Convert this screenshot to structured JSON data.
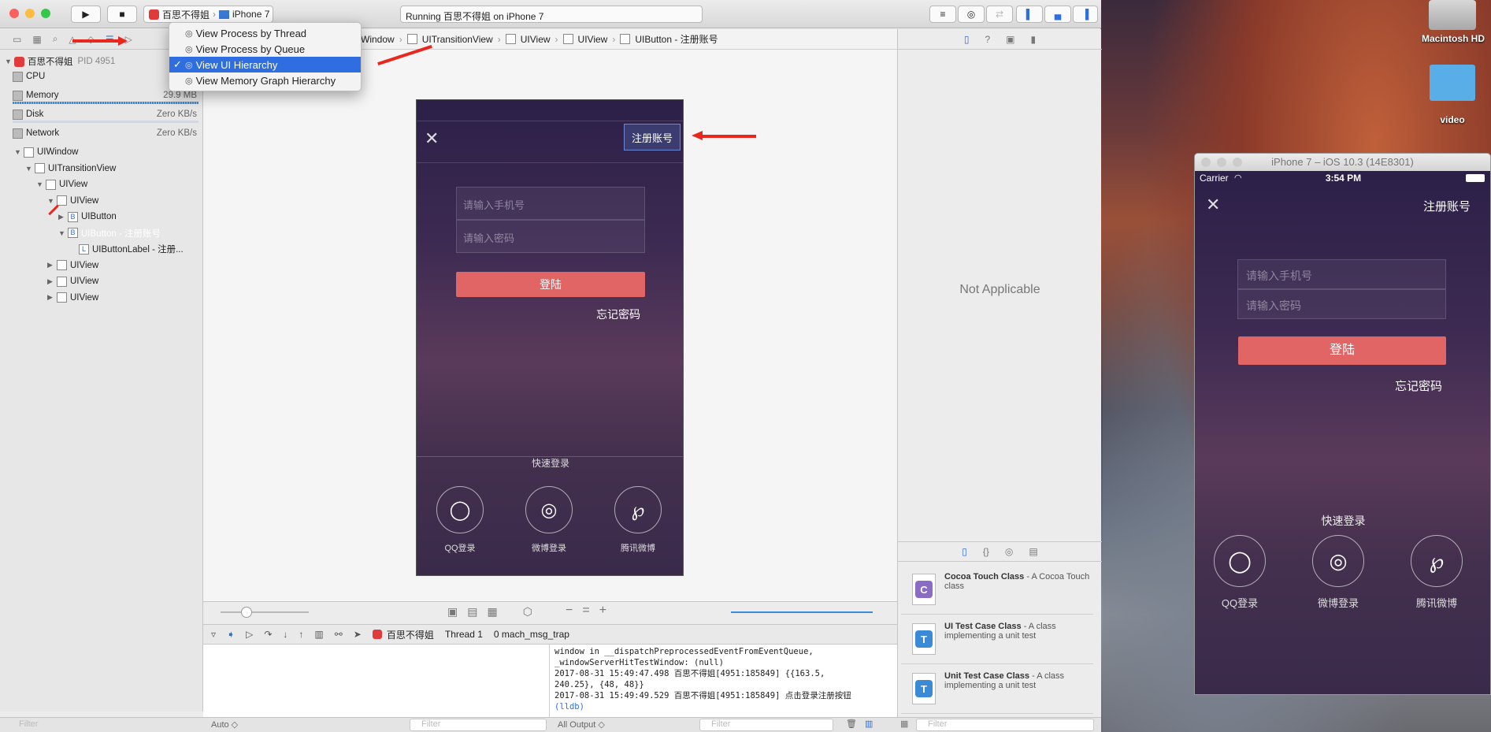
{
  "toolbar": {
    "scheme_app": "百思不得姐",
    "scheme_device": "iPhone 7",
    "status": "Running 百思不得姐 on iPhone 7"
  },
  "menu": {
    "items": [
      {
        "label": "View Process by Thread",
        "checked": false
      },
      {
        "label": "View Process by Queue",
        "checked": false
      },
      {
        "label": "View UI Hierarchy",
        "checked": true
      },
      {
        "label": "View Memory Graph Hierarchy",
        "checked": false
      }
    ],
    "checkmark": "✓"
  },
  "breadcrumb": [
    "Window",
    "UITransitionView",
    "UIView",
    "UIView",
    "UIButton - 注册账号"
  ],
  "navigator": {
    "process": "百思不得姐",
    "pid": "PID 4951",
    "gauges": [
      {
        "name": "CPU",
        "value": ""
      },
      {
        "name": "Memory",
        "value": "29.9 MB"
      },
      {
        "name": "Disk",
        "value": "Zero KB/s"
      },
      {
        "name": "Network",
        "value": "Zero KB/s"
      }
    ],
    "tree": [
      {
        "label": "UIWindow",
        "indent": 0,
        "tri": "▼",
        "badge": ""
      },
      {
        "label": "UITransitionView",
        "indent": 1,
        "tri": "▼",
        "badge": ""
      },
      {
        "label": "UIView",
        "indent": 2,
        "tri": "▼",
        "badge": ""
      },
      {
        "label": "UIView",
        "indent": 3,
        "tri": "▼",
        "badge": ""
      },
      {
        "label": "UIButton",
        "indent": 4,
        "tri": "▶",
        "badge": "B"
      },
      {
        "label": "UIButton - 注册账号",
        "indent": 4,
        "tri": "▼",
        "badge": "B"
      },
      {
        "label": "UIButtonLabel - 注册...",
        "indent": 5,
        "tri": "",
        "badge": "L"
      },
      {
        "label": "UIView",
        "indent": 3,
        "tri": "▶",
        "badge": ""
      },
      {
        "label": "UIView",
        "indent": 3,
        "tri": "▶",
        "badge": ""
      },
      {
        "label": "UIView",
        "indent": 3,
        "tri": "▶",
        "badge": ""
      }
    ],
    "filter_placeholder": "Filter"
  },
  "phone_view": {
    "register": "注册账号",
    "phone_placeholder": "请输入手机号",
    "password_placeholder": "请输入密码",
    "login": "登陆",
    "forgot": "忘记密码",
    "quick_login": "快速登录",
    "social": [
      {
        "label": "QQ登录",
        "icon": "qq-icon"
      },
      {
        "label": "微博登录",
        "icon": "weibo-icon"
      },
      {
        "label": "腾讯微博",
        "icon": "tencent-weibo-icon"
      }
    ]
  },
  "debug": {
    "app": "百思不得姐",
    "thread": "Thread 1",
    "frame": "0 mach_msg_trap",
    "console_lines": [
      "window in __dispatchPreprocessedEventFromEventQueue,",
      "_windowServerHitTestWindow: (null)",
      "2017-08-31 15:49:47.498 百思不得姐[4951:185849] {{163.5,",
      "240.25}, {48, 48}}",
      "2017-08-31 15:49:49.529 百思不得姐[4951:185849] 点击登录注册按钮",
      "(lldb)"
    ],
    "auto": "Auto ◇",
    "all_output": "All Output ◇",
    "filter": "Filter"
  },
  "inspector": {
    "not_applicable": "Not Applicable",
    "library": [
      {
        "title": "Cocoa Touch Class",
        "desc": "- A Cocoa Touch class",
        "letter": "C",
        "color": "#8a6cc4"
      },
      {
        "title": "UI Test Case Class",
        "desc": "- A class implementing a unit test",
        "letter": "T",
        "color": "#3a8ad6"
      },
      {
        "title": "Unit Test Case Class",
        "desc": "- A class implementing a unit test",
        "letter": "T",
        "color": "#3a8ad6"
      }
    ],
    "filter": "Filter"
  },
  "desktop": {
    "hd_label": "Macintosh HD",
    "folder_label": "video"
  },
  "simulator": {
    "title": "iPhone 7 – iOS 10.3 (14E8301)",
    "carrier": "Carrier",
    "time": "3:54 PM",
    "register": "注册账号",
    "phone_placeholder": "请输入手机号",
    "password_placeholder": "请输入密码",
    "login": "登陆",
    "forgot": "忘记密码",
    "quick_login": "快速登录",
    "social": [
      {
        "label": "QQ登录",
        "icon": "qq-icon"
      },
      {
        "label": "微博登录",
        "icon": "weibo-icon"
      },
      {
        "label": "腾讯微博",
        "icon": "tencent-weibo-icon"
      }
    ]
  }
}
